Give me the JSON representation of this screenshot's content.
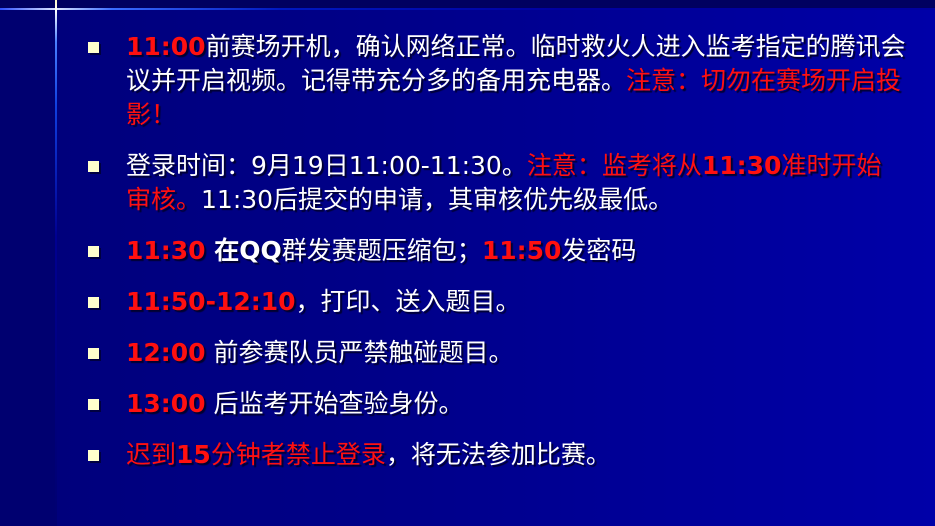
{
  "colors": {
    "background": "#000088",
    "text": "#ffffff",
    "highlight": "#ff1010",
    "bullet": "#ffffcc"
  },
  "items": [
    {
      "segments": [
        {
          "t": "11:00",
          "s": "rb"
        },
        {
          "t": "前赛场开机，确认网络正常。临时救火人进入监考指定的腾讯会议并开启视频。记得带充分多的备用充电器。",
          "s": "w"
        },
        {
          "t": "注意：切勿在赛场开启投影！",
          "s": "r"
        }
      ]
    },
    {
      "segments": [
        {
          "t": "登录时间：9月19日11:00-11:30。",
          "s": "w"
        },
        {
          "t": "注意：监考将从",
          "s": "r"
        },
        {
          "t": "11:30",
          "s": "rb"
        },
        {
          "t": "准时开始审核。",
          "s": "r"
        },
        {
          "t": "11:30后提交的申请，其审核优先级最低。",
          "s": "w"
        }
      ]
    },
    {
      "segments": [
        {
          "t": "11:30",
          "s": "rb"
        },
        {
          "t": " 在QQ",
          "s": "wb"
        },
        {
          "t": "群发赛题压缩包；",
          "s": "w"
        },
        {
          "t": "11:50",
          "s": "rb"
        },
        {
          "t": "发密码",
          "s": "w"
        }
      ]
    },
    {
      "segments": [
        {
          "t": "11:50-12:10",
          "s": "rb"
        },
        {
          "t": "，打印、送入题目。",
          "s": "w"
        }
      ]
    },
    {
      "segments": [
        {
          "t": "12:00",
          "s": "rb"
        },
        {
          "t": " 前参赛队员严禁触碰题目。",
          "s": "w"
        }
      ]
    },
    {
      "segments": [
        {
          "t": "13:00",
          "s": "rb"
        },
        {
          "t": " 后监考开始查验身份。",
          "s": "w"
        }
      ]
    },
    {
      "segments": [
        {
          "t": "迟到",
          "s": "r"
        },
        {
          "t": "15",
          "s": "rb"
        },
        {
          "t": "分钟者禁止登录",
          "s": "r"
        },
        {
          "t": "，将无法参加比赛。",
          "s": "w"
        }
      ]
    }
  ]
}
